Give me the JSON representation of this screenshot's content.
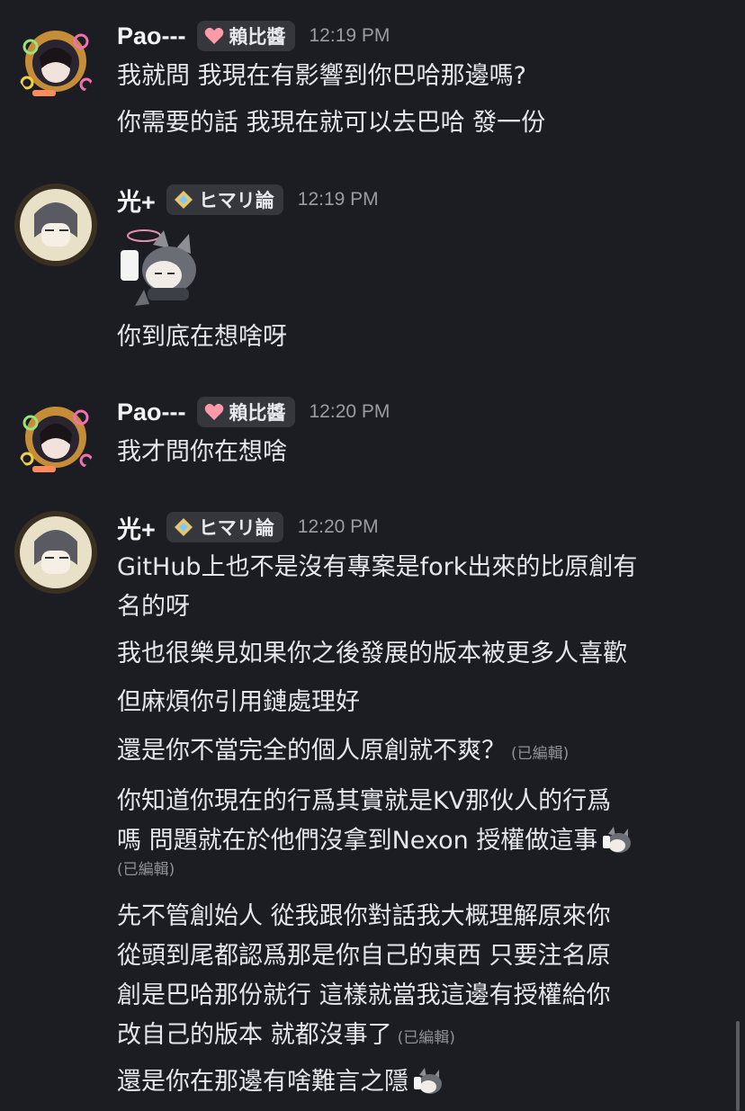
{
  "groups": [
    {
      "username": "Pao---",
      "role": "賴比醬",
      "time": "12:19 PM",
      "lines": [
        "我就問  我現在有影響到你巴哈那邊嗎?",
        "你需要的話 我現在就可以去巴哈 發一份"
      ]
    },
    {
      "username": "光+",
      "role": "ヒマリ論",
      "time": "12:19 PM",
      "lines": [
        "你到底在想啥呀"
      ]
    },
    {
      "username": "Pao---",
      "role": "賴比醬",
      "time": "12:20 PM",
      "lines": [
        "我才問你在想啥"
      ]
    },
    {
      "username": "光+",
      "role": "ヒマリ論",
      "time": "12:20 PM",
      "lines": [
        "GitHub上也不是沒有專案是fork出來的比原創有",
        "名的呀",
        "我也很樂見如果你之後發展的版本被更多人喜歡",
        "但麻煩你引用鏈處理好",
        "還是你不當完全的個人原創就不爽？",
        "你知道你現在的行爲其實就是KV那伙人的行爲",
        "嗎 問題就在於他們沒拿到Nexon 授權做這事",
        "先不管創始人 從我跟你對話我大概理解原來你",
        "從頭到尾都認爲那是你自己的東西 只要注名原",
        "創是巴哈那份就行 這樣就當我這邊有授權給你",
        "改自己的版本 就都沒事了",
        "還是你在那邊有啥難言之隱"
      ]
    }
  ],
  "edited_label": "(已編輯)",
  "colors": {
    "background": "#1c1d22",
    "text": "#e6e7ea",
    "muted": "#9a9ca3",
    "role_bg": "#35373d"
  },
  "icons": {
    "role_pao": "heart-icon",
    "role_hikari": "diamond-sparkle-icon"
  }
}
